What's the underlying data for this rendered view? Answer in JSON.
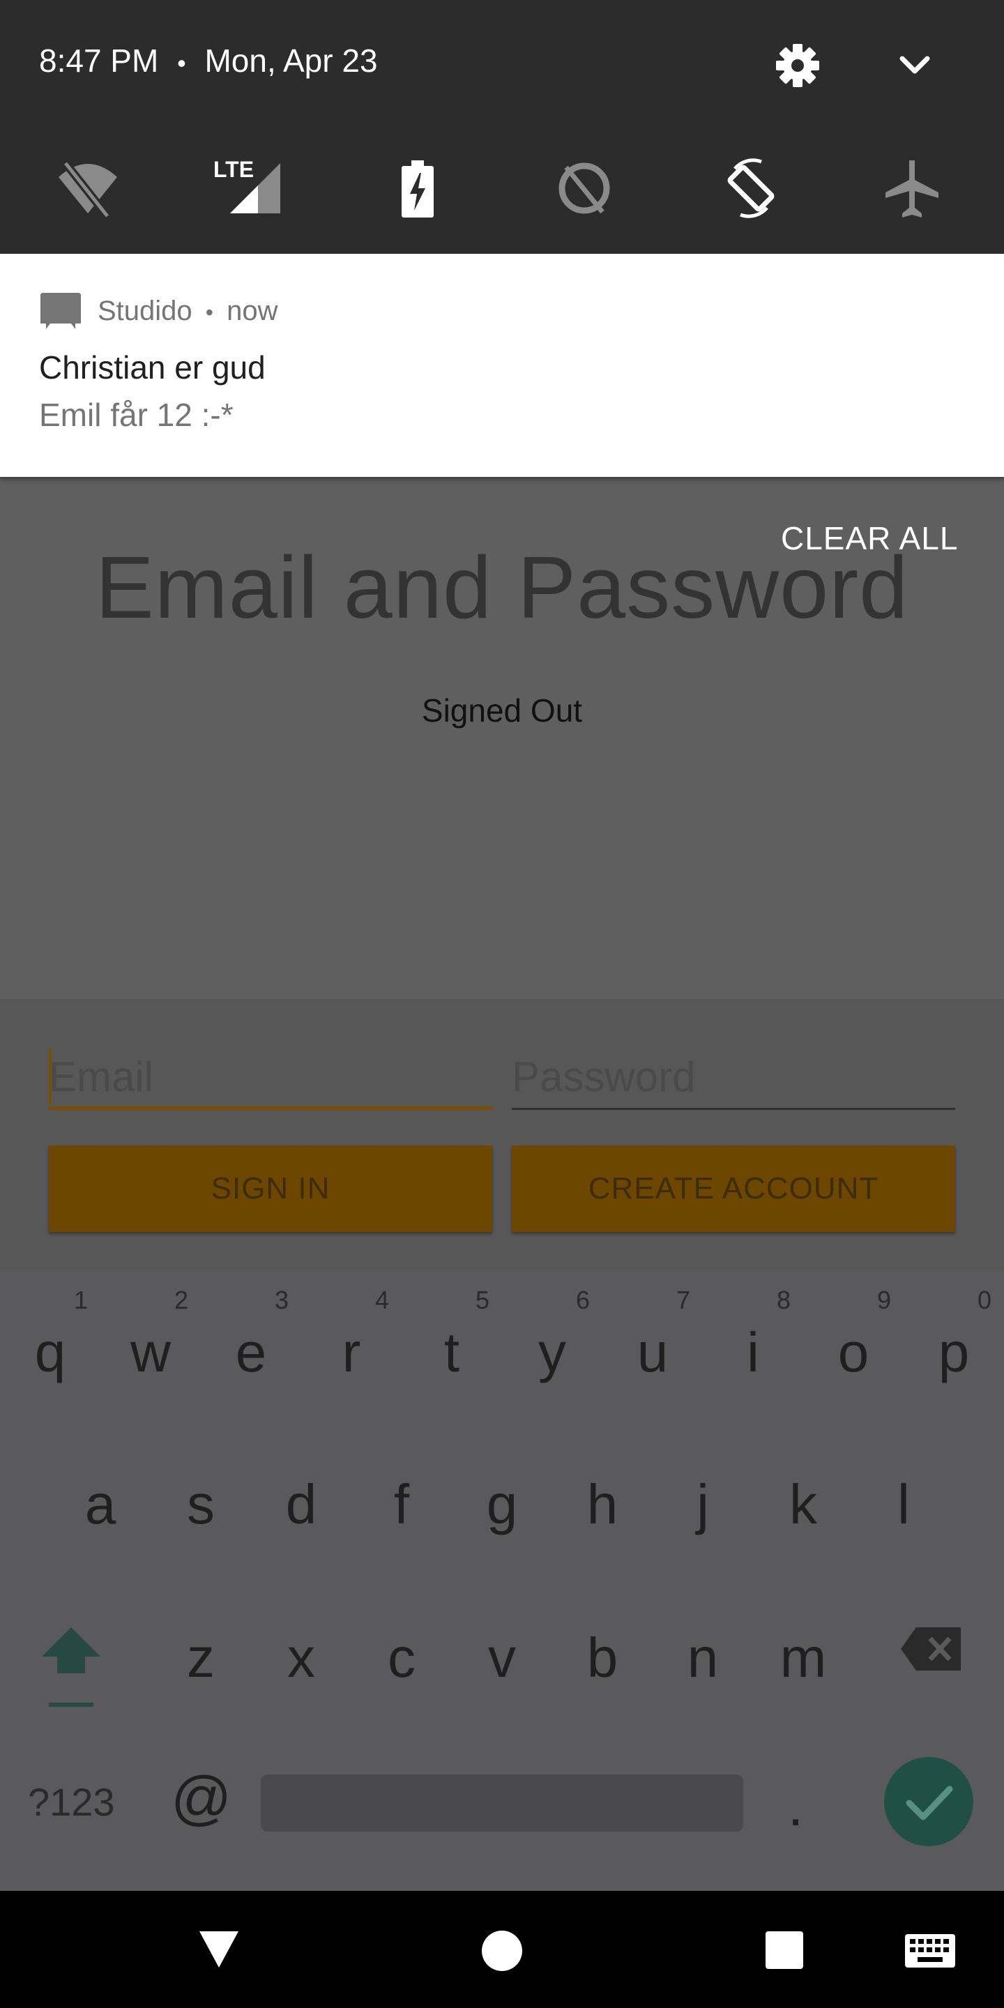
{
  "status_bar": {
    "time": "8:47 PM",
    "separator": "•",
    "date": "Mon, Apr 23"
  },
  "quick_settings": {
    "tiles": [
      {
        "name": "wifi-off-icon"
      },
      {
        "name": "lte-signal-icon",
        "label": "LTE"
      },
      {
        "name": "battery-charging-icon"
      },
      {
        "name": "data-saver-off-icon"
      },
      {
        "name": "auto-rotate-icon"
      },
      {
        "name": "airplane-mode-icon"
      }
    ]
  },
  "notification": {
    "app_name": "Studido",
    "separator": "•",
    "time": "now",
    "title": "Christian er gud",
    "text": "Emil får 12 :-*"
  },
  "shade": {
    "clear_all": "CLEAR ALL"
  },
  "app": {
    "title": "Email and Password",
    "status": "Signed Out",
    "email_placeholder": "Email",
    "password_placeholder": "Password",
    "sign_in": "SIGN IN",
    "create_account": "CREATE ACCOUNT"
  },
  "keyboard": {
    "row1": [
      "q",
      "w",
      "e",
      "r",
      "t",
      "y",
      "u",
      "i",
      "o",
      "p"
    ],
    "row1_hints": [
      "1",
      "2",
      "3",
      "4",
      "5",
      "6",
      "7",
      "8",
      "9",
      "0"
    ],
    "row2": [
      "a",
      "s",
      "d",
      "f",
      "g",
      "h",
      "j",
      "k",
      "l"
    ],
    "row3": [
      "z",
      "x",
      "c",
      "v",
      "b",
      "n",
      "m"
    ],
    "symbols": "?123",
    "at": "@",
    "period": "."
  },
  "colors": {
    "shade_bg": "#2c2c2c",
    "accent": "#7a4d00",
    "done_button": "#1f4f45"
  }
}
